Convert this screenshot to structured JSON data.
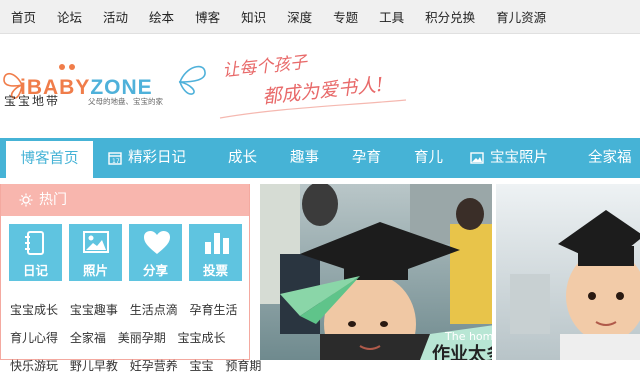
{
  "topnav": [
    "首页",
    "论坛",
    "活动",
    "绘本",
    "博客",
    "知识",
    "深度",
    "专题",
    "工具",
    "积分兑换",
    "育儿资源"
  ],
  "logo": {
    "brand_prefix": "iBABY",
    "brand_suffix": "ZONE",
    "name": "宝宝地带",
    "tagline": "父母的地盘、宝宝的家"
  },
  "slogan": {
    "line1": "让每个孩子",
    "line2": "都成为爱书人!"
  },
  "mainnav": {
    "home": "博客首页",
    "diary": "精彩日记",
    "growth": "成长",
    "fun": "趣事",
    "pregnancy": "孕育",
    "parenting": "育儿",
    "photos": "宝宝照片",
    "family": "全家福"
  },
  "hot": {
    "title": "热门",
    "tiles": [
      "日记",
      "照片",
      "分享",
      "投票"
    ],
    "links": [
      [
        "宝宝成长",
        "宝宝趣事",
        "生活点滴",
        "孕育生活"
      ],
      [
        "育儿心得",
        "全家福",
        "美丽孕期",
        "宝宝成长"
      ],
      [
        "快乐游玩",
        "野儿早教",
        "妊孕营养",
        "宝宝",
        "预育期"
      ]
    ]
  },
  "photo": {
    "caption_en": "The homework",
    "caption_cn": "作业太多"
  },
  "colors": {
    "nav_blue": "#46b3d6",
    "hot_pink": "#f8b6ae",
    "tile_blue": "#5fc4e0"
  }
}
